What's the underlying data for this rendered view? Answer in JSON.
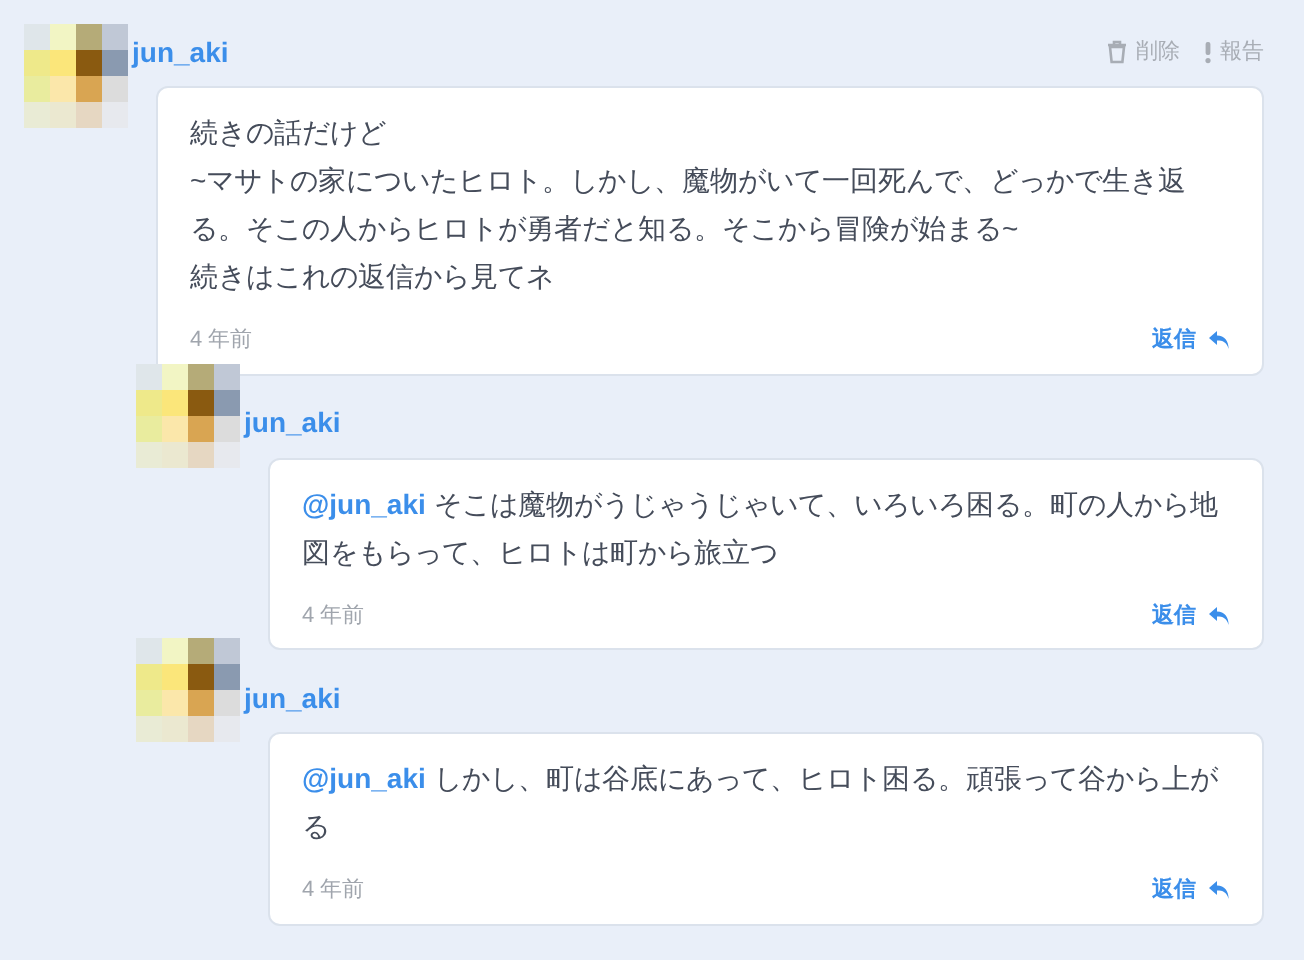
{
  "comments": [
    {
      "username": "jun_aki",
      "actions": [
        {
          "kind": "delete",
          "label": "削除"
        },
        {
          "kind": "report",
          "label": "報告"
        }
      ],
      "paragraphs": [
        "続きの話だけど",
        "~マサトの家についたヒロト。しかし、魔物がいて一回死んで、どっかで生き返る。そこの人からヒロトが勇者だと知る。そこから冒険が始まる~",
        "続きはこれの返信から見てネ"
      ],
      "time": "4 年前",
      "reply": "返信",
      "children": [
        {
          "username": "jun_aki",
          "mention": "@jun_aki",
          "paragraphs": [
            "そこは魔物がうじゃうじゃいて、いろいろ困る。町の人から地図をもらって、ヒロトは町から旅立つ"
          ],
          "time": "4 年前",
          "reply": "返信"
        },
        {
          "username": "jun_aki",
          "mention": "@jun_aki",
          "paragraphs": [
            "しかし、町は谷底にあって、ヒロト困る。頑張って谷から上がる"
          ],
          "time": "4 年前",
          "reply": "返信"
        }
      ]
    }
  ]
}
